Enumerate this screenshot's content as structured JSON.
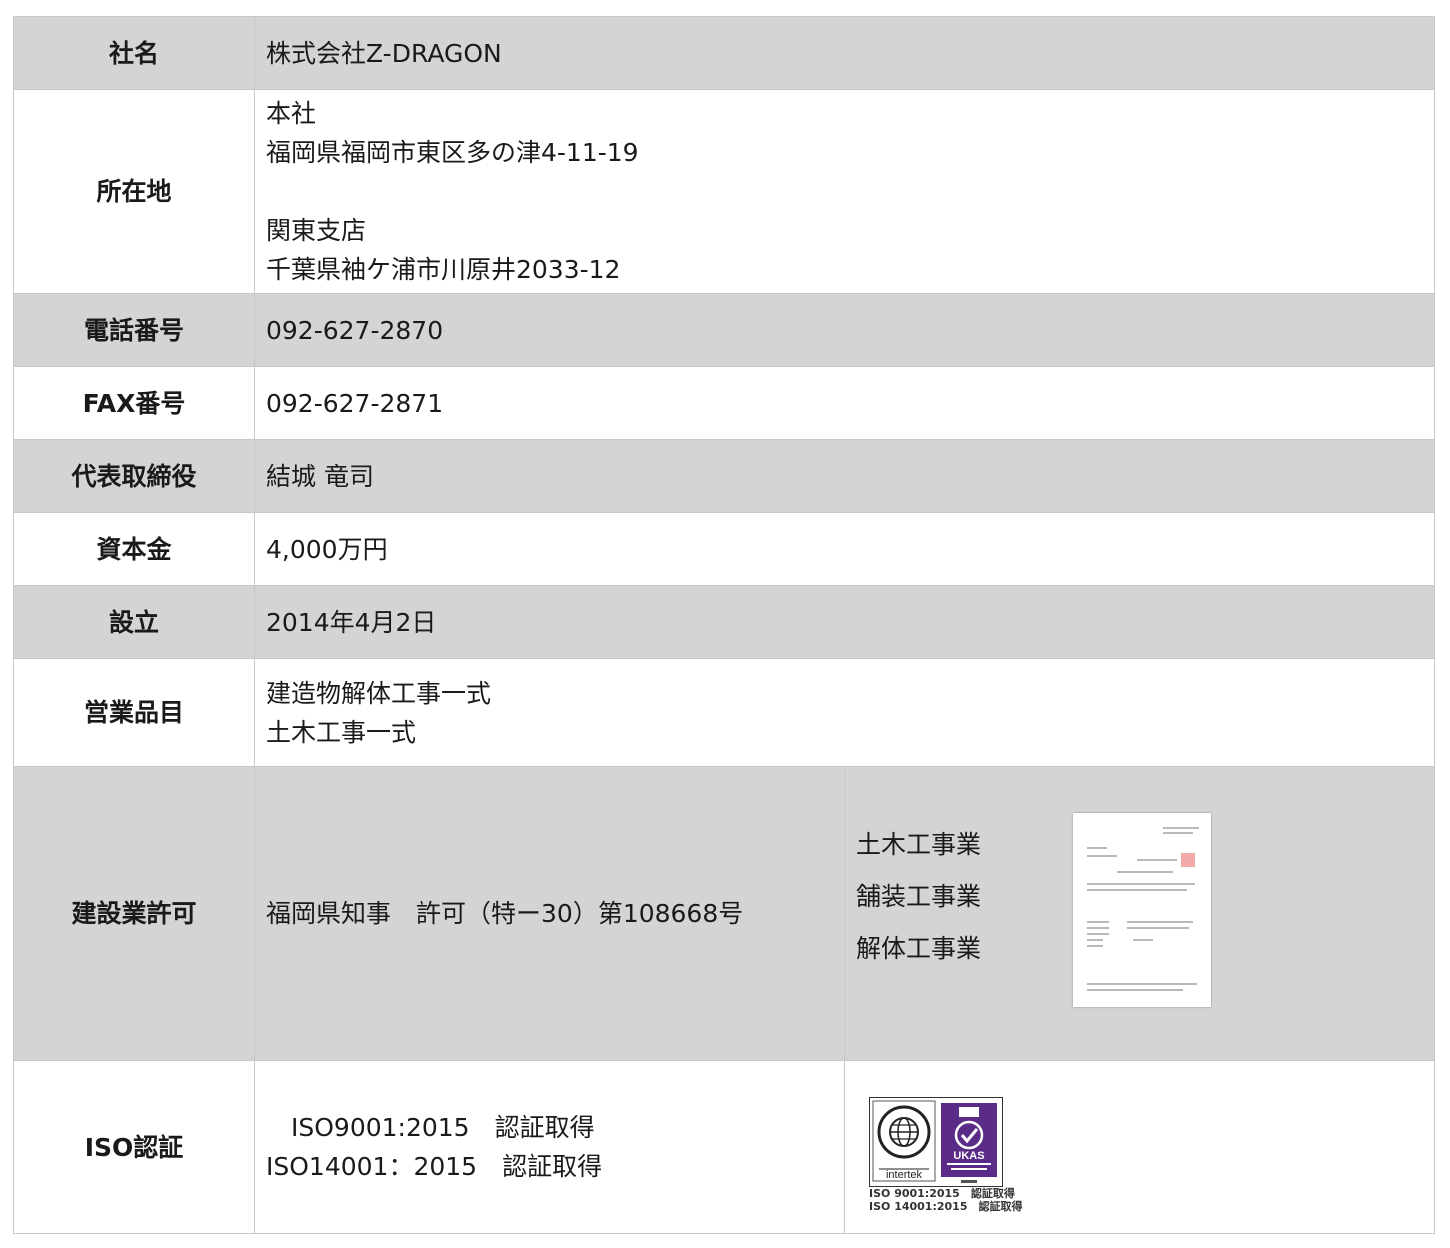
{
  "rows": {
    "company": {
      "label": "社名",
      "value": "株式会社Z-DRAGON"
    },
    "location": {
      "label": "所在地",
      "head_office_title": "本社",
      "head_office_address": "福岡県福岡市東区多の津4-11-19",
      "branch_title": "関東支店",
      "branch_address": "千葉県袖ケ浦市川原井2033-12"
    },
    "phone": {
      "label": "電話番号",
      "value": "092-627-2870"
    },
    "fax": {
      "label": "FAX番号",
      "value": "092-627-2871"
    },
    "representative": {
      "label": "代表取締役",
      "value": "結城 竜司"
    },
    "capital": {
      "label": "資本金",
      "value": "4,000万円"
    },
    "established": {
      "label": "設立",
      "value": "2014年4月2日"
    },
    "business": {
      "label": "営業品目",
      "items": [
        "建造物解体工事一式",
        "土木工事一式"
      ]
    },
    "license": {
      "label": "建設業許可",
      "value": "福岡県知事　許可（特ー30）第108668号",
      "types": [
        "土木工事業",
        "舗装工事業",
        "解体工事業"
      ]
    },
    "iso": {
      "label": "ISO認証",
      "lines": [
        "　ISO9001:2015　認証取得",
        "ISO14001：2015　認証取得"
      ],
      "logo_caption": [
        "ISO 9001:2015　認証取得",
        "ISO 14001:2015　認証取得"
      ]
    }
  },
  "colors": {
    "gray_row": "#d4d4d4",
    "border": "#c8c8c8",
    "ukas_purple": "#5b2c87"
  }
}
